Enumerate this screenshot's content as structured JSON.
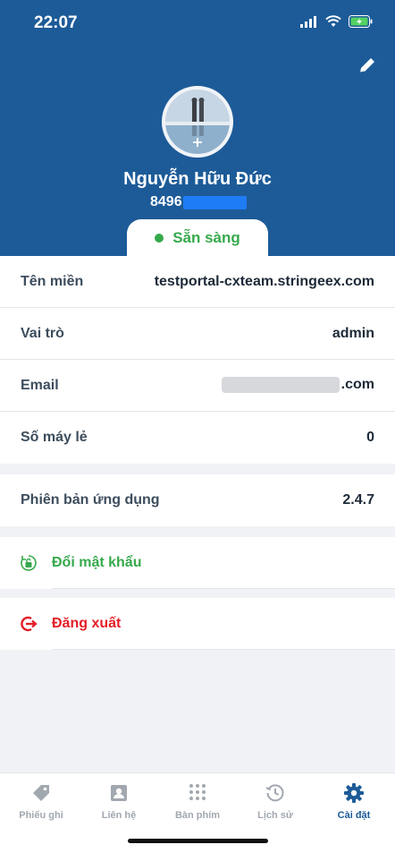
{
  "status_bar": {
    "time": "22:07"
  },
  "profile": {
    "name": "Nguyễn Hữu Đức",
    "phone_prefix": "8496",
    "status": "Sẵn sàng"
  },
  "info_rows": [
    {
      "label": "Tên miền",
      "value": "testportal-cxteam.stringeex.com"
    },
    {
      "label": "Vai trò",
      "value": "admin"
    },
    {
      "label": "Email",
      "value": ".com"
    },
    {
      "label": "Số máy lẻ",
      "value": "0"
    }
  ],
  "app_version": {
    "label": "Phiên bản ứng dụng",
    "value": "2.4.7"
  },
  "actions": {
    "change_password": "Đổi mật khẩu",
    "logout": "Đăng xuất"
  },
  "tabs": [
    {
      "label": "Phiếu ghi",
      "icon": "tag-icon"
    },
    {
      "label": "Liên hệ",
      "icon": "contact-icon"
    },
    {
      "label": "Bàn phím",
      "icon": "keypad-icon"
    },
    {
      "label": "Lịch sử",
      "icon": "history-icon"
    },
    {
      "label": "Cài đặt",
      "icon": "gear-icon",
      "active": true
    }
  ],
  "colors": {
    "header": "#1d5b98",
    "status_green": "#36a94b",
    "logout_red": "#e41e26",
    "active_tab": "#1d5b98",
    "inactive_tab": "#a2a8b0"
  }
}
